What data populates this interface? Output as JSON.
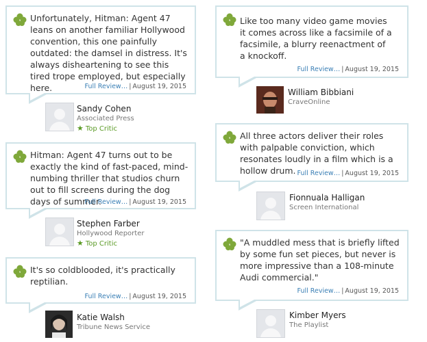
{
  "colors": {
    "accent": "#3a7fb5",
    "top_critic": "#5a9a24",
    "bubble_border": "#cfe3e8"
  },
  "icons": {
    "review": "fresh-splat-icon",
    "top_critic": "star-icon"
  },
  "link_label": "Full Review…",
  "separator": "|",
  "reviews": [
    {
      "quote": "Unfortunately, Hitman: Agent 47 leans on another familiar Hollywood convention, this one painfully outdated: the damsel in distress. It's always disheartening to see this tired trope employed, but especially here.",
      "date": "August 19, 2015",
      "critic": "Sandy Cohen",
      "publication": "Associated Press",
      "top_critic": "Top Critic"
    },
    {
      "quote": "Hitman: Agent 47 turns out to be exactly the kind of fast-paced, mind-numbing thriller that studios churn out to fill screens during the dog days of summer.",
      "date": "August 19, 2015",
      "critic": "Stephen Farber",
      "publication": "Hollywood Reporter",
      "top_critic": "Top Critic"
    },
    {
      "quote": "It's so coldblooded, it's practically reptilian.",
      "date": "August 19, 2015",
      "critic": "Katie Walsh",
      "publication": "Tribune News Service"
    },
    {
      "quote": "Like too many video game movies it comes across like a facsimile of a facsimile, a blurry reenactment of a knockoff.",
      "date": "August 19, 2015",
      "critic": "William Bibbiani",
      "publication": "CraveOnline"
    },
    {
      "quote": "All three actors deliver their roles with palpable conviction, which resonates loudly in a film which is a hollow drum.",
      "date": "August 19, 2015",
      "critic": "Fionnuala Halligan",
      "publication": "Screen International"
    },
    {
      "quote": "\"A muddled mess that is briefly lifted by some fun set pieces, but never is more impressive than a 108-minute Audi commercial.\"",
      "date": "August 19, 2015",
      "critic": "Kimber Myers",
      "publication": "The Playlist"
    }
  ]
}
